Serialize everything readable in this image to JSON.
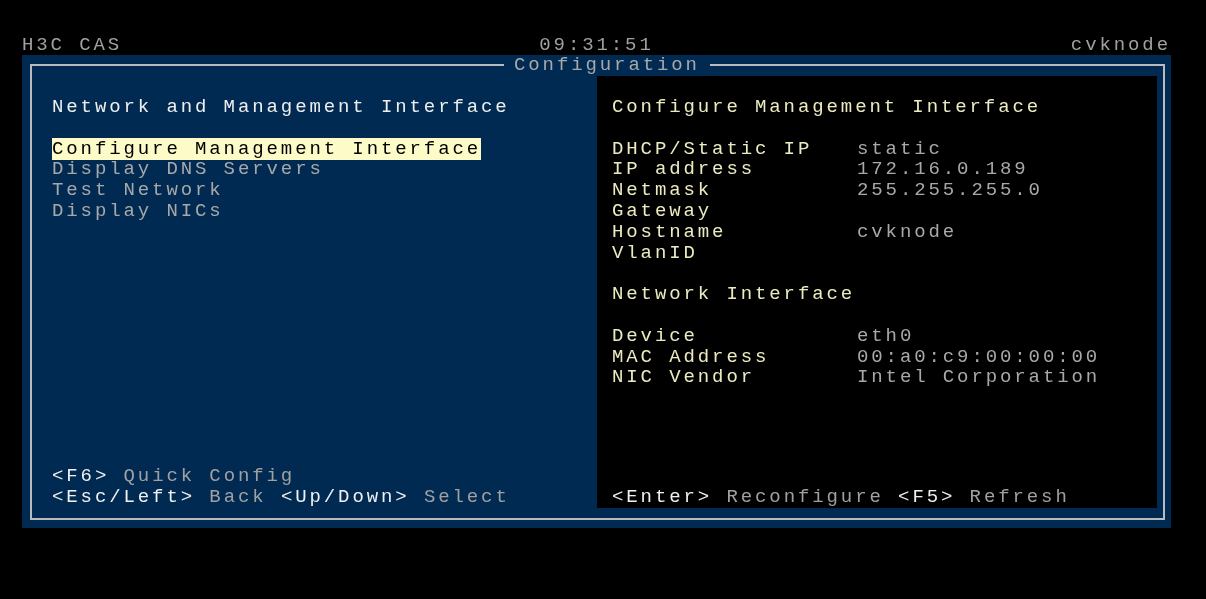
{
  "header": {
    "product": "H3C CAS",
    "time": "09:31:51",
    "host": "cvknode"
  },
  "dialog": {
    "title": "Configuration"
  },
  "menu": {
    "title": "Network and Management Interface",
    "items": [
      {
        "label": "Configure Management Interface",
        "selected": true
      },
      {
        "label": "Display DNS Servers",
        "selected": false
      },
      {
        "label": "Test Network",
        "selected": false
      },
      {
        "label": "Display NICs",
        "selected": false
      }
    ],
    "hint_lines": [
      [
        {
          "key": "<F6>",
          "action": "Quick Config"
        }
      ],
      [
        {
          "key": "<Esc/Left>",
          "action": "Back"
        },
        {
          "key": "<Up/Down>",
          "action": "Select"
        }
      ]
    ]
  },
  "details": {
    "title": "Configure Management Interface",
    "fields": [
      {
        "label": "DHCP/Static IP",
        "value": "static"
      },
      {
        "label": "IP address",
        "value": "172.16.0.189"
      },
      {
        "label": "Netmask",
        "value": "255.255.255.0"
      },
      {
        "label": "Gateway"
      },
      {
        "label": "Hostname",
        "value": "cvknode"
      },
      {
        "label": "VlanID"
      }
    ],
    "section": "Network Interface",
    "nic_fields": [
      {
        "label": "Device",
        "value": "eth0"
      },
      {
        "label": "MAC Address",
        "value": "00:a0:c9:00:00:00"
      },
      {
        "label": "NIC Vendor",
        "value": "Intel Corporation"
      }
    ],
    "hints": [
      {
        "key": "<Enter>",
        "action": "Reconfigure"
      },
      {
        "key": "<F5>",
        "action": "Refresh"
      }
    ]
  }
}
